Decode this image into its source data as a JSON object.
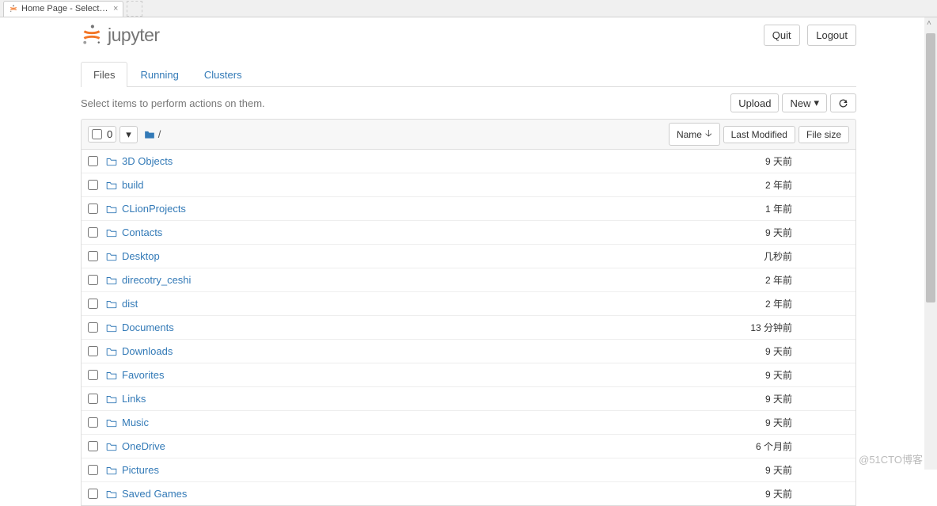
{
  "browser_tab": {
    "title": "Home Page - Select or c..."
  },
  "header": {
    "logo_text": "jupyter",
    "quit": "Quit",
    "logout": "Logout"
  },
  "tabs": {
    "files": "Files",
    "running": "Running",
    "clusters": "Clusters"
  },
  "hint": "Select items to perform actions on them.",
  "toolbar": {
    "upload": "Upload",
    "new": "New",
    "refresh_title": "Refresh notebook list"
  },
  "selectall_count": "0",
  "breadcrumb_sep": "/",
  "columns": {
    "name": "Name",
    "last_modified": "Last Modified",
    "file_size": "File size"
  },
  "items": [
    {
      "name": "3D Objects",
      "modified": "9 天前",
      "size": ""
    },
    {
      "name": "build",
      "modified": "2 年前",
      "size": ""
    },
    {
      "name": "CLionProjects",
      "modified": "1 年前",
      "size": ""
    },
    {
      "name": "Contacts",
      "modified": "9 天前",
      "size": ""
    },
    {
      "name": "Desktop",
      "modified": "几秒前",
      "size": ""
    },
    {
      "name": "direcotry_ceshi",
      "modified": "2 年前",
      "size": ""
    },
    {
      "name": "dist",
      "modified": "2 年前",
      "size": ""
    },
    {
      "name": "Documents",
      "modified": "13 分钟前",
      "size": ""
    },
    {
      "name": "Downloads",
      "modified": "9 天前",
      "size": ""
    },
    {
      "name": "Favorites",
      "modified": "9 天前",
      "size": ""
    },
    {
      "name": "Links",
      "modified": "9 天前",
      "size": ""
    },
    {
      "name": "Music",
      "modified": "9 天前",
      "size": ""
    },
    {
      "name": "OneDrive",
      "modified": "6 个月前",
      "size": ""
    },
    {
      "name": "Pictures",
      "modified": "9 天前",
      "size": ""
    },
    {
      "name": "Saved Games",
      "modified": "9 天前",
      "size": ""
    }
  ],
  "watermark": "@51CTO博客"
}
